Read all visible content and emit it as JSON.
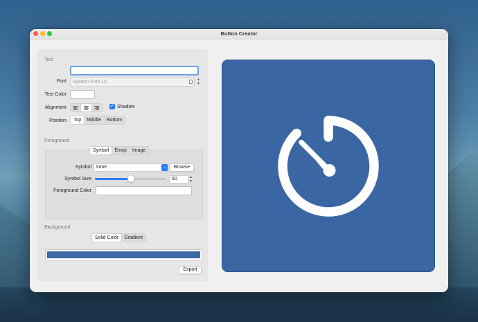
{
  "window": {
    "title": "Button Creator"
  },
  "text_section": {
    "header": "Text",
    "text_value": "",
    "font_label": "Font",
    "font_placeholder": "System Font 16",
    "text_color_label": "Text Color",
    "alignment_label": "Alignment",
    "alignment_options": [
      "left",
      "center",
      "right"
    ],
    "alignment_selected": "center",
    "shadow_label": "Shadow",
    "shadow_checked": true,
    "position_label": "Position",
    "position_options": [
      "Top",
      "Middle",
      "Bottom"
    ],
    "position_selected": "Top"
  },
  "foreground_section": {
    "header": "Foreground",
    "tabs": [
      "Symbol",
      "Emoji",
      "Image"
    ],
    "tab_selected": "Symbol",
    "symbol_label": "Symbol",
    "symbol_value": "timer",
    "browse_label": "Browse",
    "symbol_size_label": "Symbol Size",
    "symbol_size_value": "50",
    "symbol_size_fraction": 0.5,
    "foreground_color_label": "Foreground Color"
  },
  "background_section": {
    "header": "Background",
    "tabs": [
      "Solid Color",
      "Gradient"
    ],
    "tab_selected": "Solid Color",
    "color": "#3a6aa6"
  },
  "export_label": "Export",
  "preview": {
    "background_color": "#3a67a4",
    "symbol": "timer-icon",
    "symbol_color": "#ffffff"
  }
}
